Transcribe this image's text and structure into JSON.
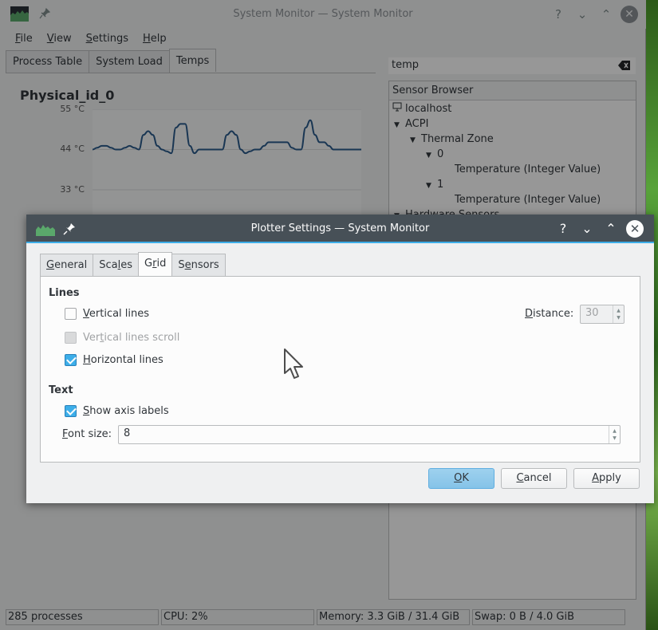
{
  "main_window": {
    "title": "System Monitor — System Monitor",
    "menu": [
      {
        "label": "File",
        "mnemonic": "F",
        "rest": "ile"
      },
      {
        "label": "View",
        "mnemonic": "V",
        "rest": "iew"
      },
      {
        "label": "Settings",
        "mnemonic": "S",
        "rest": "ettings"
      },
      {
        "label": "Help",
        "mnemonic": "H",
        "rest": "elp"
      }
    ],
    "tabs": [
      {
        "label": "Process Table"
      },
      {
        "label": "System Load"
      },
      {
        "label": "Temps",
        "active": true
      }
    ],
    "search": {
      "value": "temp",
      "clear_icon": "clear-text-icon"
    },
    "sensor_browser": {
      "header": "Sensor Browser",
      "tree": [
        {
          "label": "localhost",
          "icon": "monitor-icon",
          "level": 0
        },
        {
          "label": "ACPI",
          "expanded": true,
          "level": 0
        },
        {
          "label": "Thermal Zone",
          "expanded": true,
          "level": 1
        },
        {
          "label": "0",
          "expanded": true,
          "level": 2
        },
        {
          "label": "Temperature (Integer Value)",
          "level": 3
        },
        {
          "label": "1",
          "expanded": true,
          "level": 2
        },
        {
          "label": "Temperature (Integer Value)",
          "level": 3
        },
        {
          "label": "Hardware Sensors",
          "expanded": true,
          "level": 0
        }
      ]
    },
    "status": {
      "processes": "285 processes",
      "cpu": "CPU: 2%",
      "memory": "Memory: 3.3 GiB / 31.4 GiB",
      "swap": "Swap: 0 B / 4.0 GiB"
    }
  },
  "chart_data": {
    "type": "line",
    "title": "Physical_id_0",
    "ylabel": "",
    "xlabel": "",
    "y_ticks": [
      "55 °C",
      "44 °C",
      "33 °C"
    ],
    "y_tick_values": [
      55,
      44,
      33
    ],
    "ylim": [
      30,
      55
    ],
    "grid": "horizontal",
    "line_color": "#2b5a8a",
    "series": [
      {
        "name": "Physical_id_0",
        "values": [
          44,
          44.5,
          45,
          45,
          44.5,
          44,
          44,
          44.5,
          45,
          44.5,
          44,
          48,
          49,
          48,
          45,
          44,
          43.5,
          43,
          50,
          51,
          51,
          45,
          43,
          44,
          44,
          44,
          44,
          44,
          44,
          48,
          49,
          48,
          44,
          43,
          43.5,
          44,
          44,
          45,
          46,
          46,
          46,
          46,
          46,
          44.5,
          44,
          44,
          50,
          52,
          48,
          46,
          46,
          45,
          44,
          44,
          44,
          44,
          44,
          44,
          44
        ]
      }
    ]
  },
  "dialog": {
    "title": "Plotter Settings — System Monitor",
    "tabs": [
      {
        "label": "General",
        "mnemonic_index": 0
      },
      {
        "label": "Scales",
        "mnemonic_index": 3
      },
      {
        "label": "Grid",
        "mnemonic_index": 1,
        "active": true
      },
      {
        "label": "Sensors",
        "mnemonic_index": 1
      }
    ],
    "lines_group": "Lines",
    "vertical_lines": {
      "label": "Vertical lines",
      "checked": false
    },
    "vertical_lines_scroll": {
      "label": "Vertical lines scroll",
      "checked": false,
      "disabled": true
    },
    "horizontal_lines": {
      "label": "Horizontal lines",
      "checked": true
    },
    "distance": {
      "label": "Distance:",
      "value": "30",
      "disabled": true
    },
    "text_group": "Text",
    "show_axis_labels": {
      "label": "Show axis labels",
      "checked": true
    },
    "font_size": {
      "label": "Font size:",
      "value": "8"
    },
    "buttons": {
      "ok": "OK",
      "cancel": "Cancel",
      "apply": "Apply"
    }
  }
}
